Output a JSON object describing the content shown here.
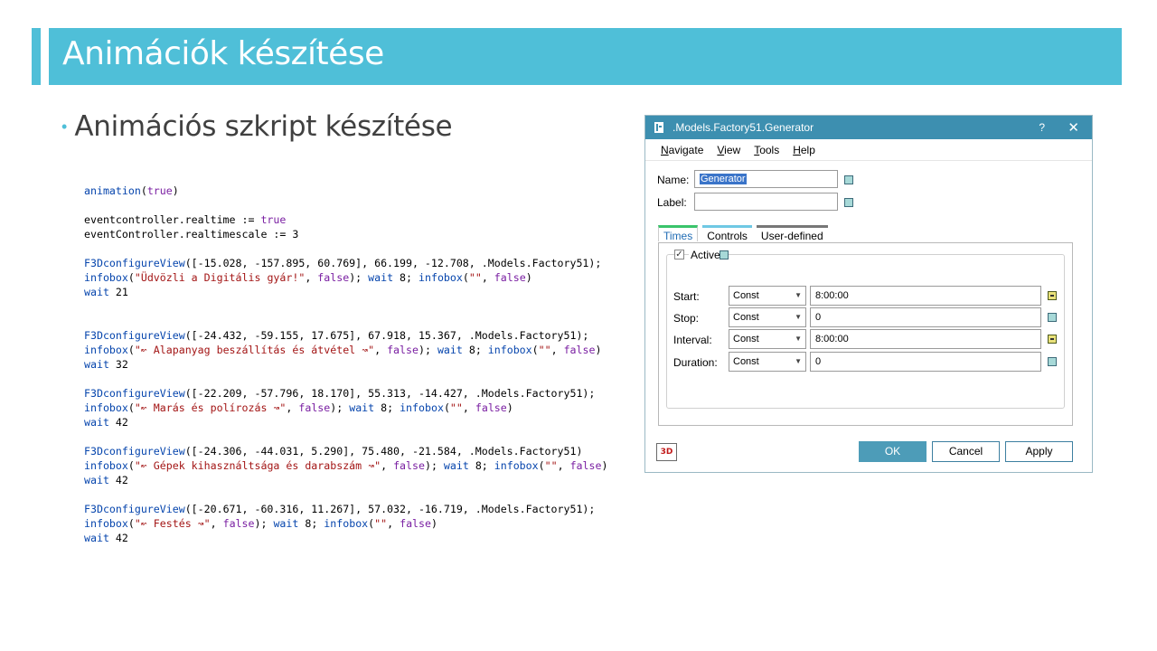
{
  "slide": {
    "title": "Animációk készítése",
    "bullet": "Animációs szkript készítése"
  },
  "code": [
    [
      {
        "t": "animation",
        "c": "k"
      },
      {
        "t": "("
      },
      {
        "t": "true",
        "c": "v"
      },
      {
        "t": ")"
      }
    ],
    [],
    [
      {
        "t": "eventcontroller.realtime := "
      },
      {
        "t": "true",
        "c": "v"
      }
    ],
    [
      {
        "t": "eventController.realtimescale := 3"
      }
    ],
    [],
    [
      {
        "t": "F3DconfigureView",
        "c": "k"
      },
      {
        "t": "([-15.028, -157.895, 60.769], 66.199, -12.708, .Models.Factory51);"
      }
    ],
    [
      {
        "t": "infobox",
        "c": "k"
      },
      {
        "t": "("
      },
      {
        "t": "\"Üdvözli a Digitális gyár!\"",
        "c": "s"
      },
      {
        "t": ", "
      },
      {
        "t": "false",
        "c": "v"
      },
      {
        "t": "); "
      },
      {
        "t": "wait",
        "c": "k"
      },
      {
        "t": " 8; "
      },
      {
        "t": "infobox",
        "c": "k"
      },
      {
        "t": "("
      },
      {
        "t": "\"\"",
        "c": "s"
      },
      {
        "t": ", "
      },
      {
        "t": "false",
        "c": "v"
      },
      {
        "t": ")"
      }
    ],
    [
      {
        "t": "wait",
        "c": "k"
      },
      {
        "t": " 21"
      }
    ],
    [],
    [],
    [
      {
        "t": "F3DconfigureView",
        "c": "k"
      },
      {
        "t": "([-24.432, -59.155, 17.675], 67.918, 15.367, .Models.Factory51);"
      }
    ],
    [
      {
        "t": "infobox",
        "c": "k"
      },
      {
        "t": "("
      },
      {
        "t": "\"↜ Alapanyag beszállítás és átvétel ↝\"",
        "c": "s"
      },
      {
        "t": ", "
      },
      {
        "t": "false",
        "c": "v"
      },
      {
        "t": "); "
      },
      {
        "t": "wait",
        "c": "k"
      },
      {
        "t": " 8; "
      },
      {
        "t": "infobox",
        "c": "k"
      },
      {
        "t": "("
      },
      {
        "t": "\"\"",
        "c": "s"
      },
      {
        "t": ", "
      },
      {
        "t": "false",
        "c": "v"
      },
      {
        "t": ")"
      }
    ],
    [
      {
        "t": "wait",
        "c": "k"
      },
      {
        "t": " 32"
      }
    ],
    [],
    [
      {
        "t": "F3DconfigureView",
        "c": "k"
      },
      {
        "t": "([-22.209, -57.796, 18.170], 55.313, -14.427, .Models.Factory51);"
      }
    ],
    [
      {
        "t": "infobox",
        "c": "k"
      },
      {
        "t": "("
      },
      {
        "t": "\"↜ Marás és polírozás ↝\"",
        "c": "s"
      },
      {
        "t": ", "
      },
      {
        "t": "false",
        "c": "v"
      },
      {
        "t": "); "
      },
      {
        "t": "wait",
        "c": "k"
      },
      {
        "t": " 8; "
      },
      {
        "t": "infobox",
        "c": "k"
      },
      {
        "t": "("
      },
      {
        "t": "\"\"",
        "c": "s"
      },
      {
        "t": ", "
      },
      {
        "t": "false",
        "c": "v"
      },
      {
        "t": ")"
      }
    ],
    [
      {
        "t": "wait",
        "c": "k"
      },
      {
        "t": " 42"
      }
    ],
    [],
    [
      {
        "t": "F3DconfigureView",
        "c": "k"
      },
      {
        "t": "([-24.306, -44.031, 5.290], 75.480, -21.584, .Models.Factory51)"
      }
    ],
    [
      {
        "t": "infobox",
        "c": "k"
      },
      {
        "t": "("
      },
      {
        "t": "\"↜ Gépek kihasználtsága és darabszám ↝\"",
        "c": "s"
      },
      {
        "t": ", "
      },
      {
        "t": "false",
        "c": "v"
      },
      {
        "t": "); "
      },
      {
        "t": "wait",
        "c": "k"
      },
      {
        "t": " 8; "
      },
      {
        "t": "infobox",
        "c": "k"
      },
      {
        "t": "("
      },
      {
        "t": "\"\"",
        "c": "s"
      },
      {
        "t": ", "
      },
      {
        "t": "false",
        "c": "v"
      },
      {
        "t": ")"
      }
    ],
    [
      {
        "t": "wait",
        "c": "k"
      },
      {
        "t": " 42"
      }
    ],
    [],
    [
      {
        "t": "F3DconfigureView",
        "c": "k"
      },
      {
        "t": "([-20.671, -60.316, 11.267], 57.032, -16.719, .Models.Factory51);"
      }
    ],
    [
      {
        "t": "infobox",
        "c": "k"
      },
      {
        "t": "("
      },
      {
        "t": "\"↜ Festés ↝\"",
        "c": "s"
      },
      {
        "t": ", "
      },
      {
        "t": "false",
        "c": "v"
      },
      {
        "t": "); "
      },
      {
        "t": "wait",
        "c": "k"
      },
      {
        "t": " 8; "
      },
      {
        "t": "infobox",
        "c": "k"
      },
      {
        "t": "("
      },
      {
        "t": "\"\"",
        "c": "s"
      },
      {
        "t": ", "
      },
      {
        "t": "false",
        "c": "v"
      },
      {
        "t": ")"
      }
    ],
    [
      {
        "t": "wait",
        "c": "k"
      },
      {
        "t": " 42"
      }
    ]
  ],
  "dialog": {
    "title": ".Models.Factory51.Generator",
    "help": "?",
    "close": "✕",
    "menu": [
      {
        "u": "N",
        "rest": "avigate"
      },
      {
        "u": "V",
        "rest": "iew"
      },
      {
        "u": "T",
        "rest": "ools"
      },
      {
        "u": "H",
        "rest": "elp"
      }
    ],
    "name_label": "Name:",
    "name_value": "Generator",
    "label_label": "Label:",
    "label_value": "",
    "tabs": [
      "Times",
      "Controls",
      "User-defined"
    ],
    "active_label": "Active",
    "active_checked": true,
    "rows": [
      {
        "label": "Start:",
        "mode": "Const",
        "value": "8:00:00"
      },
      {
        "label": "Stop:",
        "mode": "Const",
        "value": "0"
      },
      {
        "label": "Interval:",
        "mode": "Const",
        "value": "8:00:00"
      },
      {
        "label": "Duration:",
        "mode": "Const",
        "value": "0"
      }
    ],
    "logo": "3D",
    "ok": "OK",
    "cancel": "Cancel",
    "apply": "Apply"
  }
}
